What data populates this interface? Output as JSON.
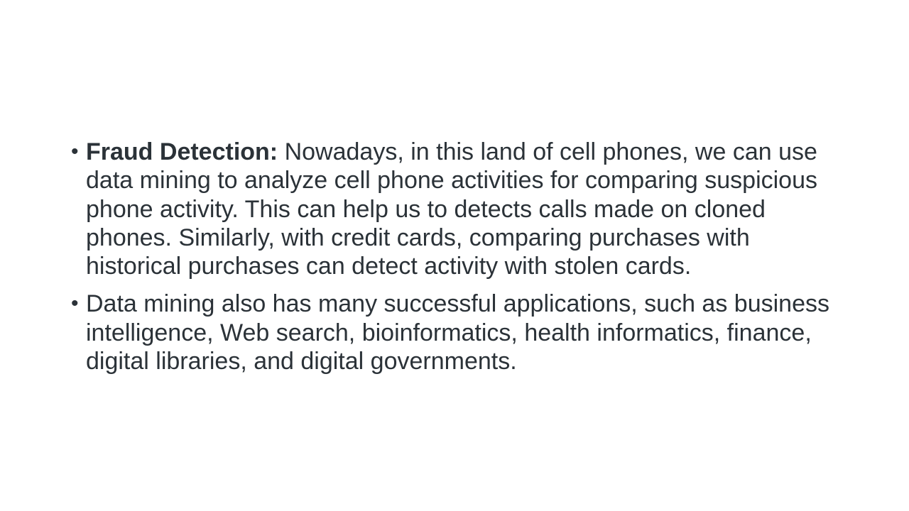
{
  "slide": {
    "bullets": [
      {
        "marker": "•",
        "bold_prefix": "Fraud Detection:",
        "text": " Nowadays, in this land of cell phones, we can use data mining to analyze cell phone activities for comparing suspicious phone activity. This can help us to detects calls made on cloned phones. Similarly, with credit cards, comparing purchases with historical purchases can detect activity with stolen cards."
      },
      {
        "marker": "•",
        "text": "Data mining also has many successful applications, such as business intelligence, Web search, bioinformatics, health informatics, finance, digital libraries, and digital governments."
      }
    ]
  },
  "colors": {
    "text": "#2b3238",
    "background": "#ffffff"
  }
}
